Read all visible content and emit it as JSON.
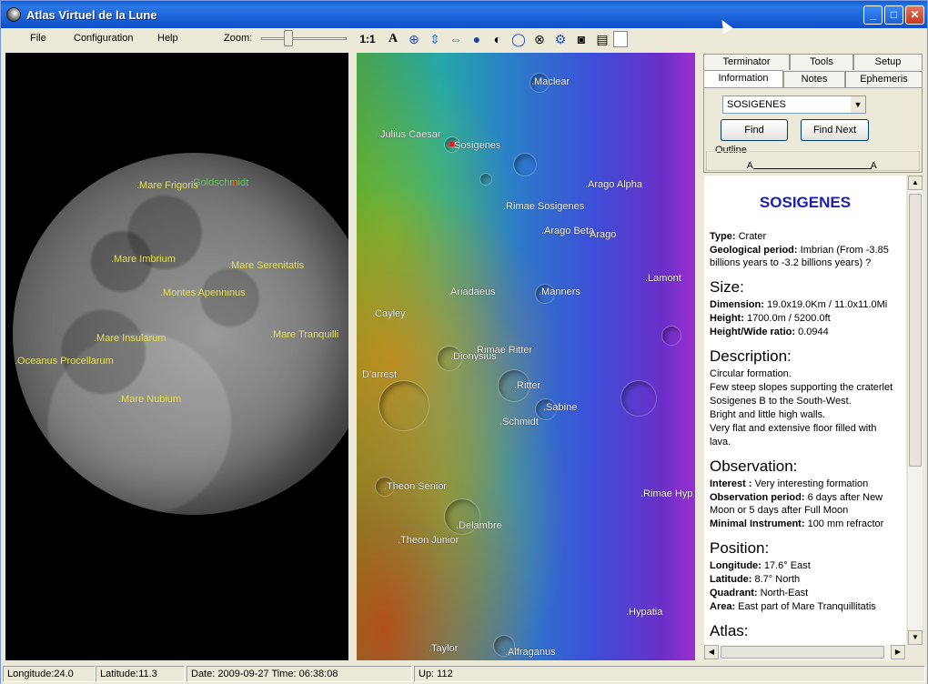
{
  "window": {
    "title": "Atlas Virtuel de la Lune"
  },
  "menu": {
    "file": "File",
    "configuration": "Configuration",
    "help": "Help",
    "zoom_label": "Zoom:"
  },
  "toolbar": {
    "one_to_one": "1:1",
    "text_tool": "A"
  },
  "left_view": {
    "labels": [
      {
        "text": ".Mare Frigoris"
      },
      {
        "text": ".Mare Imbrium"
      },
      {
        "text": ".Mare Serenitatis"
      },
      {
        "text": ".Montes Apenninus"
      },
      {
        "text": ".Mare Insularum"
      },
      {
        "text": ".Mare Tranquilli"
      },
      {
        "text": ".Oceanus Procellarum"
      },
      {
        "text": ".Mare Nubium"
      }
    ],
    "marker_label": "Goldschmidt"
  },
  "map_view": {
    "labels": [
      {
        "text": ".Maclear"
      },
      {
        "text": ".Julius Caesar"
      },
      {
        "text": ".Sosigenes"
      },
      {
        "text": ".Arago Alpha"
      },
      {
        "text": ".Rimae Sosigenes"
      },
      {
        "text": ".Arago Beta"
      },
      {
        "text": "Arago"
      },
      {
        "text": ".Lamont"
      },
      {
        "text": ".Ariadaeus"
      },
      {
        "text": ".Manners"
      },
      {
        "text": ".Cayley"
      },
      {
        "text": ".Rimae Ritter"
      },
      {
        "text": ".Dionysius"
      },
      {
        "text": "D'arrest"
      },
      {
        "text": ".Ritter"
      },
      {
        "text": ".Sabine"
      },
      {
        "text": ".Schmidt"
      },
      {
        "text": ".Theon Senior"
      },
      {
        "text": ".Rimae Hyp"
      },
      {
        "text": ".Delambre"
      },
      {
        "text": ".Theon Junior"
      },
      {
        "text": ".Hypatia"
      },
      {
        "text": ".Taylor"
      },
      {
        "text": ".Alfraganus"
      }
    ]
  },
  "tabs": {
    "row1": [
      "Terminator",
      "Tools",
      "Setup"
    ],
    "row2": [
      "Information",
      "Notes",
      "Ephemeris"
    ]
  },
  "info_panel": {
    "selected": "SOSIGENES",
    "find": "Find",
    "find_next": "Find Next",
    "outline_label": "Outline",
    "outline_a1": "A",
    "outline_a2": "A",
    "title": "SOSIGENES",
    "type_label": "Type:",
    "type_value": " Crater",
    "geo_label": "Geological period:",
    "geo_value": " Imbrian (From -3.85 billions years to -3.2 billions years) ?",
    "size_heading": "Size:",
    "dimension_label": "Dimension:",
    "dimension_value": " 19.0x19.0Km / 11.0x11.0Mi",
    "height_label": "Height:",
    "height_value": " 1700.0m / 5200.0ft",
    "ratio_label": "Height/Wide ratio:",
    "ratio_value": " 0.0944",
    "description_heading": "Description:",
    "description_lines": [
      "Circular formation.",
      "Few steep slopes supporting the craterlet",
      "Sosigenes B to the South-West.",
      "Bright and little high walls.",
      "Very flat and extensive floor filled with",
      "lava."
    ],
    "observation_heading": "Observation:",
    "interest_label": "Interest :",
    "interest_value": " Very interesting formation",
    "obs_period_label": "Observation period:",
    "obs_period_value": " 6 days after New Moon or 5 days after Full Moon",
    "min_instr_label": "Minimal Instrument:",
    "min_instr_value": " 100 mm refractor",
    "position_heading": "Position:",
    "longitude_label": "Longitude:",
    "longitude_value": " 17.6° East",
    "latitude_label": "Latitude:",
    "latitude_value": " 8.7° North",
    "quadrant_label": "Quadrant:",
    "quadrant_value": " North-East",
    "area_label": "Area:",
    "area_value": " East part of Mare Tranquillitatis",
    "atlas_heading": "Atlas:"
  },
  "status": {
    "longitude": "Longitude:24.0",
    "latitude": "Latitude:11.3",
    "datetime": "Date: 2009-09-27   Time: 06:38:08",
    "up": "Up: 112"
  }
}
